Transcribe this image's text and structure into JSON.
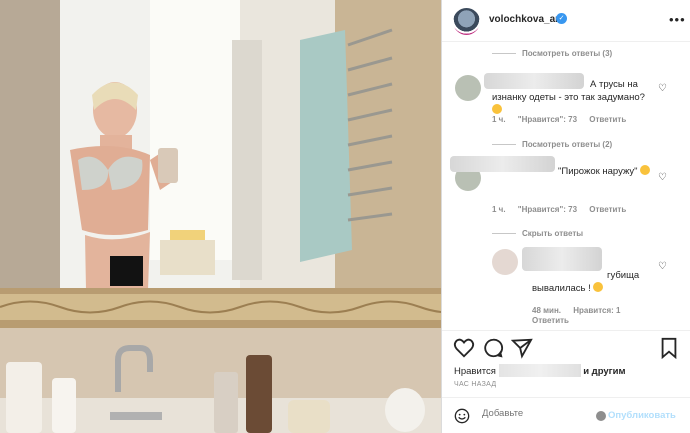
{
  "post": {
    "username": "volochkova_art",
    "verified_icon": "verified-badge-icon",
    "more_icon": "more-options-icon"
  },
  "comments": [
    {
      "view_replies": "Посмотреть ответы (3)"
    },
    {
      "text": "А трусы на изнанку одеты - это так задумано?",
      "time": "1 ч.",
      "likes": "\"Нравится\": 73",
      "reply": "Ответить",
      "view_replies": "Посмотреть ответы (2)"
    },
    {
      "text": "\"Пирожок наружу\"",
      "time": "1 ч.",
      "likes": "\"Нравится\": 73",
      "reply": "Ответить",
      "hide_replies": "Скрыть ответы"
    },
    {
      "text": "губища вывалилась !",
      "time": "48 мин.",
      "likes": "Нравится: 1",
      "reply": "Ответить"
    }
  ],
  "actions": {
    "likes_prefix": "Нравится",
    "likes_suffix": "и другим",
    "timestamp": "ЧАС НАЗАД"
  },
  "comment_box": {
    "placeholder": "Добавьте",
    "publish_label": "Опубликовать"
  },
  "colors": {
    "accent": "#3897f0",
    "publish_disabled": "#b2dffc",
    "meta": "#8e8e8e"
  }
}
